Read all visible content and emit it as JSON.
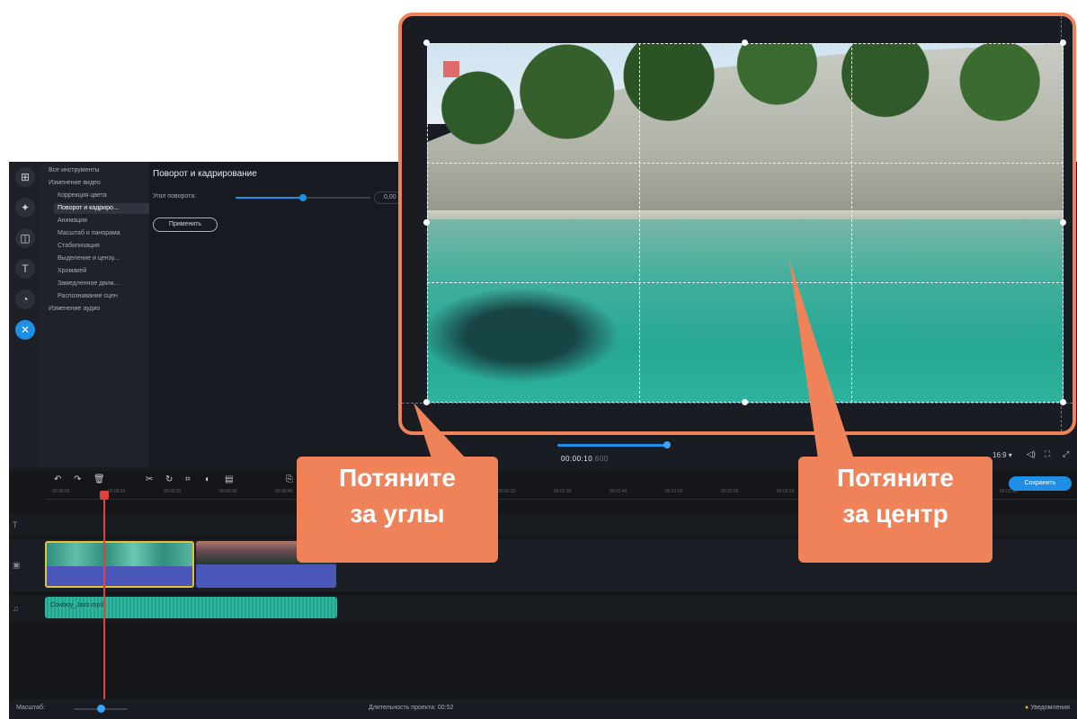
{
  "tools_list": {
    "items": [
      {
        "label": "Все инструменты",
        "level": "top"
      },
      {
        "label": "Изменение видео",
        "level": "top"
      },
      {
        "label": "Коррекция цвета",
        "level": "sub"
      },
      {
        "label": "Поворот и кадриро...",
        "level": "sub",
        "selected": true
      },
      {
        "label": "Анимация",
        "level": "sub"
      },
      {
        "label": "Масштаб и панорама",
        "level": "sub"
      },
      {
        "label": "Стабилизация",
        "level": "sub"
      },
      {
        "label": "Выделение и цензу...",
        "level": "sub"
      },
      {
        "label": "Хромакей",
        "level": "sub"
      },
      {
        "label": "Замедленное движ...",
        "level": "sub"
      },
      {
        "label": "Распознавание сцен",
        "level": "sub"
      },
      {
        "label": "Изменение аудио",
        "level": "top"
      }
    ]
  },
  "props": {
    "title": "Поворот и кадрирование",
    "rotation_label": "Угол поворота:",
    "rotation_slider_fraction": 0.5,
    "rotation_value": "0,00",
    "apply_label": "Применить"
  },
  "player": {
    "timecode": "00:00:10",
    "timecode_ms": ".600",
    "aspect": "16:9 ▾",
    "seek_fraction": 0.35
  },
  "timeline": {
    "ruler_labels": [
      "00:00:00",
      "00:00:10",
      "00:00:20",
      "00:00:30",
      "00:00:40",
      "00:00:50",
      "00:01:00",
      "00:01:10",
      "00:01:20",
      "00:01:30",
      "00:01:40",
      "00:01:50",
      "00:02:00",
      "00:02:10",
      "00:02:20",
      "00:02:30",
      "00:02:40",
      "00:02:50"
    ],
    "save_label": "Сохранить",
    "audio_clip_label": "Cowboy_Jazz.mp3"
  },
  "status": {
    "scale_label": "Масштаб:",
    "duration": "Длительность проекта: 00:52",
    "notifications": "Уведомления"
  },
  "callouts": {
    "corners": [
      "Потяните",
      "за углы"
    ],
    "center": [
      "Потяните",
      "за центр"
    ]
  },
  "colors": {
    "accent": "#1f8fe6",
    "callout": "#f0825a",
    "playhead": "#e0423f",
    "selected_clip_border": "#e2c23a",
    "audio_clip": "#2fb7a0"
  },
  "icons": {
    "left_toolbar": [
      "import-icon",
      "filters-icon",
      "transitions-icon",
      "titles-icon",
      "stickers-icon",
      "more-tools-icon"
    ]
  }
}
